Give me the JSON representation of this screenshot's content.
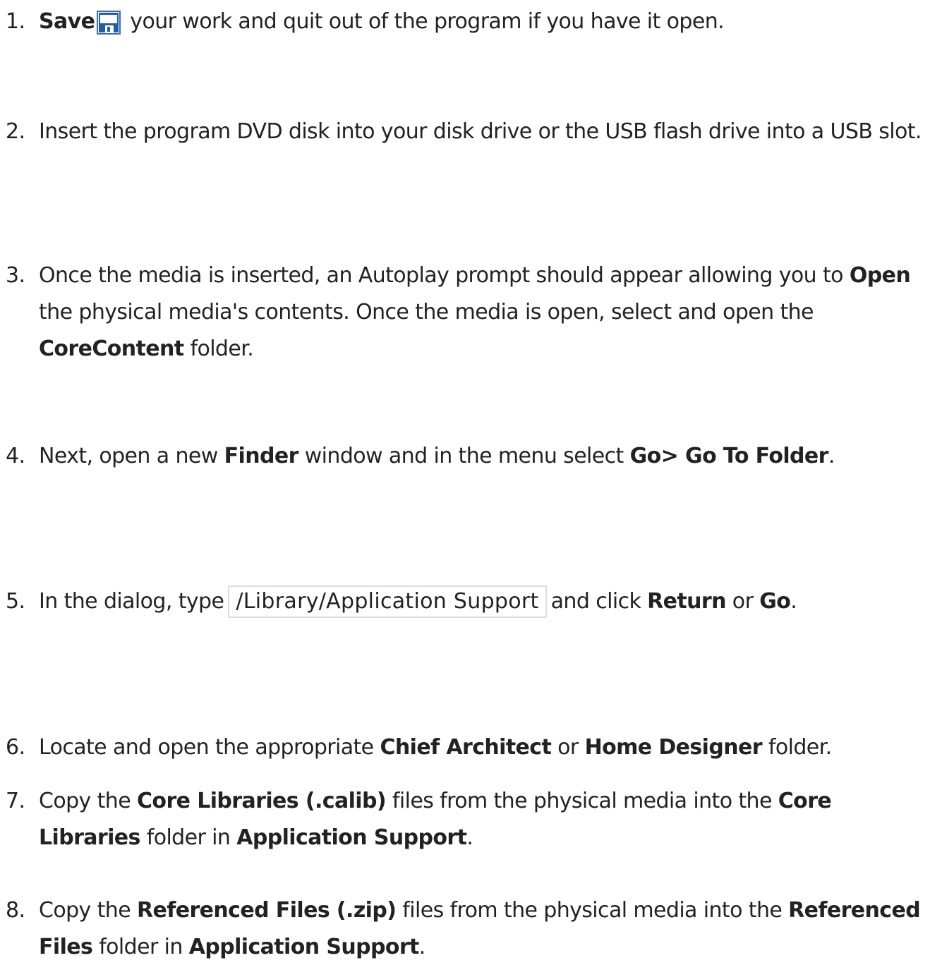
{
  "steps": [
    {
      "number": "1.",
      "save": "Save",
      "after_icon": " your work and quit out of the program if you have it open.",
      "icon": "floppy-disk-save-icon"
    },
    {
      "number": "2.",
      "text": "Insert the program DVD disk into your disk drive or the USB flash drive into a USB slot."
    },
    {
      "number": "3.",
      "part1": "Once the media is inserted, an Autoplay prompt should appear allowing you to ",
      "open": "Open",
      "part2": " the physical media's contents. Once the media is open, select and open the ",
      "folder": "CoreContent",
      "part3": " folder."
    },
    {
      "number": "4.",
      "part1": "Next, open a new ",
      "finder": "Finder",
      "part2": " window and in the menu select ",
      "menu": "Go> Go To Folder",
      "part3": "."
    },
    {
      "number": "5.",
      "part1": "In the dialog, type",
      "path": "/Library/Application Support",
      "part2": "and click ",
      "return": "Return",
      "part3": " or ",
      "go": "Go",
      "part4": "."
    },
    {
      "number": "6.",
      "part1": "Locate and open the appropriate ",
      "chief": "Chief Architect",
      "part2": " or ",
      "home": "Home Designer",
      "part3": " folder."
    },
    {
      "number": "7.",
      "part1": "Copy the ",
      "core_files": "Core Libraries (.calib)",
      "part2": " files from the physical media into the ",
      "core_folder": "Core Libraries",
      "part3": " folder in ",
      "app_support": "Application Support",
      "part4": "."
    },
    {
      "number": "8.",
      "part1": "Copy the ",
      "ref_files": "Referenced Files (.zip)",
      "part2": " files from the physical media into the ",
      "ref_folder": "Referenced Files",
      "part3": " folder in ",
      "app_support": "Application Support",
      "part4": "."
    }
  ],
  "colors": {
    "text": "#222222",
    "icon_blue": "#1f5fa8",
    "icon_light": "#ffffff",
    "path_border": "#dcdcdc"
  }
}
